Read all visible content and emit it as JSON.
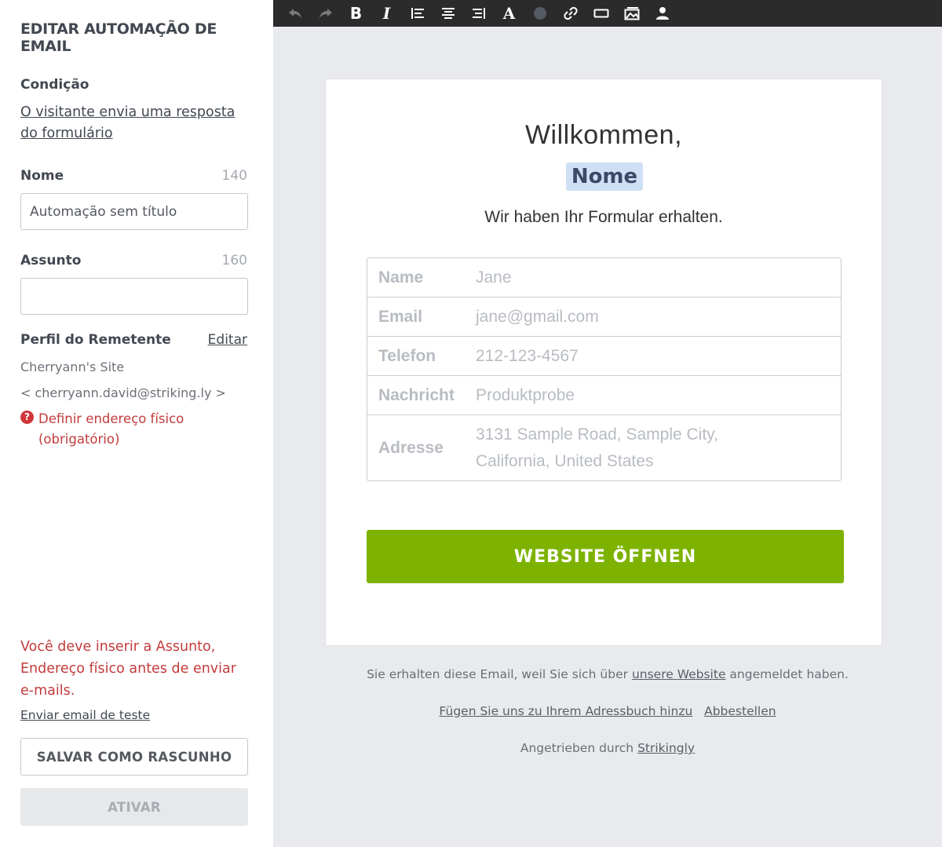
{
  "sidebar": {
    "title": "EDITAR AUTOMAÇÃO DE EMAIL",
    "condition_label": "Condição",
    "condition_link": "O visitante envia uma resposta do formulário",
    "name_label": "Nome",
    "name_count": "140",
    "name_value": "Automação sem título",
    "subject_label": "Assunto",
    "subject_count": "160",
    "subject_value": "",
    "sender_label": "Perfil do Remetente",
    "sender_edit": "Editar",
    "sender_name": "Cherryann's Site",
    "sender_email": "< cherryann.david@striking.ly >",
    "warning_text": "Definir endereço físico (obrigatório)",
    "error_text": "Você deve inserir a Assunto, Endereço físico antes de enviar e-mails.",
    "test_link": "Enviar email de teste",
    "draft_button": "SALVAR COMO RASCUNHO",
    "activate_button": "ATIVAR"
  },
  "toolbar": {
    "icons": [
      "undo-icon",
      "redo-icon",
      "bold-icon",
      "italic-icon",
      "align-left-icon",
      "align-center-icon",
      "align-right-icon",
      "font-color-icon",
      "color-dot-icon",
      "link-icon",
      "button-icon",
      "image-icon",
      "user-icon"
    ],
    "bold": "B",
    "italic": "I",
    "font": "A"
  },
  "email": {
    "greeting": "Willkommen,",
    "name_tag": "Nome",
    "received": "Wir haben Ihr Formular erhalten.",
    "fields": [
      {
        "key": "Name",
        "value": "Jane"
      },
      {
        "key": "Email",
        "value": "jane@gmail.com"
      },
      {
        "key": "Telefon",
        "value": "212-123-4567"
      },
      {
        "key": "Nachricht",
        "value": "Produktprobe"
      },
      {
        "key": "Adresse",
        "value": "3131 Sample Road, Sample City, California, United States"
      }
    ],
    "cta": "WEBSITE ÖFFNEN",
    "accent": "#7db300"
  },
  "footer": {
    "line1_pre": "Sie erhalten diese Email, weil Sie sich über",
    "line1_link": "unsere Website",
    "line1_post": "angemeldet haben.",
    "addressbook": "Fügen Sie uns zu Ihrem Adressbuch hinzu",
    "unsubscribe": "Abbestellen",
    "powered_pre": "Angetrieben durch",
    "powered_link": "Strikingly"
  }
}
